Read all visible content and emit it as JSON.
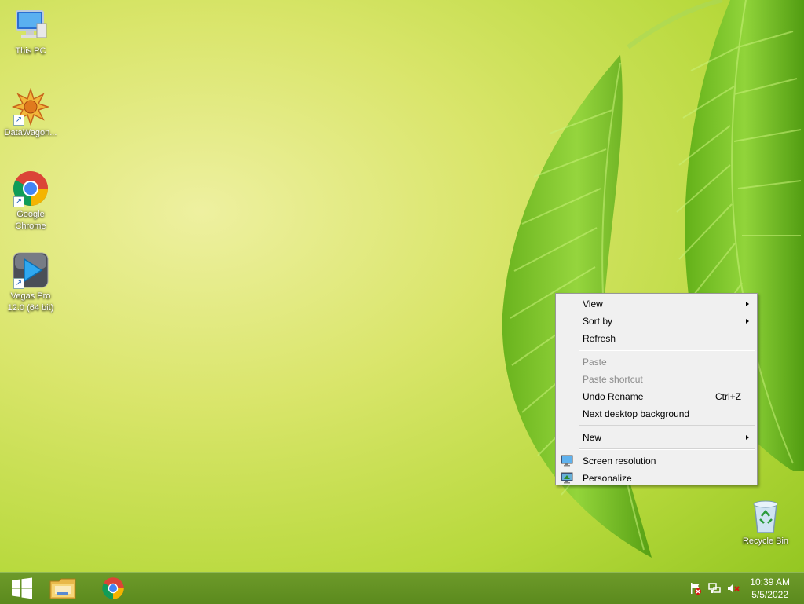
{
  "desktop": {
    "icons": [
      {
        "label": "This PC"
      },
      {
        "label": "DataWagon..."
      },
      {
        "label_line1": "Google",
        "label_line2": "Chrome"
      },
      {
        "label_line1": "Vegas Pro",
        "label_line2": "12.0 (64 bit)"
      },
      {
        "label": "Recycle Bin"
      }
    ]
  },
  "context_menu": {
    "items": [
      {
        "label": "View",
        "submenu": true,
        "enabled": true
      },
      {
        "label": "Sort by",
        "submenu": true,
        "enabled": true
      },
      {
        "label": "Refresh",
        "enabled": true
      },
      {
        "label": "Paste",
        "enabled": false
      },
      {
        "label": "Paste shortcut",
        "enabled": false
      },
      {
        "label": "Undo Rename",
        "shortcut": "Ctrl+Z",
        "enabled": true
      },
      {
        "label": "Next desktop background",
        "enabled": true
      },
      {
        "label": "New",
        "submenu": true,
        "enabled": true
      },
      {
        "label": "Screen resolution",
        "icon": "screen-resolution-icon",
        "enabled": true
      },
      {
        "label": "Personalize",
        "icon": "personalize-icon",
        "enabled": true
      }
    ]
  },
  "taskbar": {
    "start_icon": "windows-logo-icon",
    "pinned": [
      {
        "name": "file-explorer",
        "icon": "folder-icon"
      },
      {
        "name": "google-chrome",
        "icon": "chrome-icon"
      }
    ],
    "tray": {
      "icons": [
        "action-center-flag-icon",
        "network-icon",
        "volume-muted-icon"
      ],
      "time": "10:39 AM",
      "date": "5/5/2022"
    }
  },
  "colors": {
    "taskbar": "#5b8a1d",
    "menu_background": "#f0f0f0",
    "disabled_text": "#8c8c8c"
  }
}
